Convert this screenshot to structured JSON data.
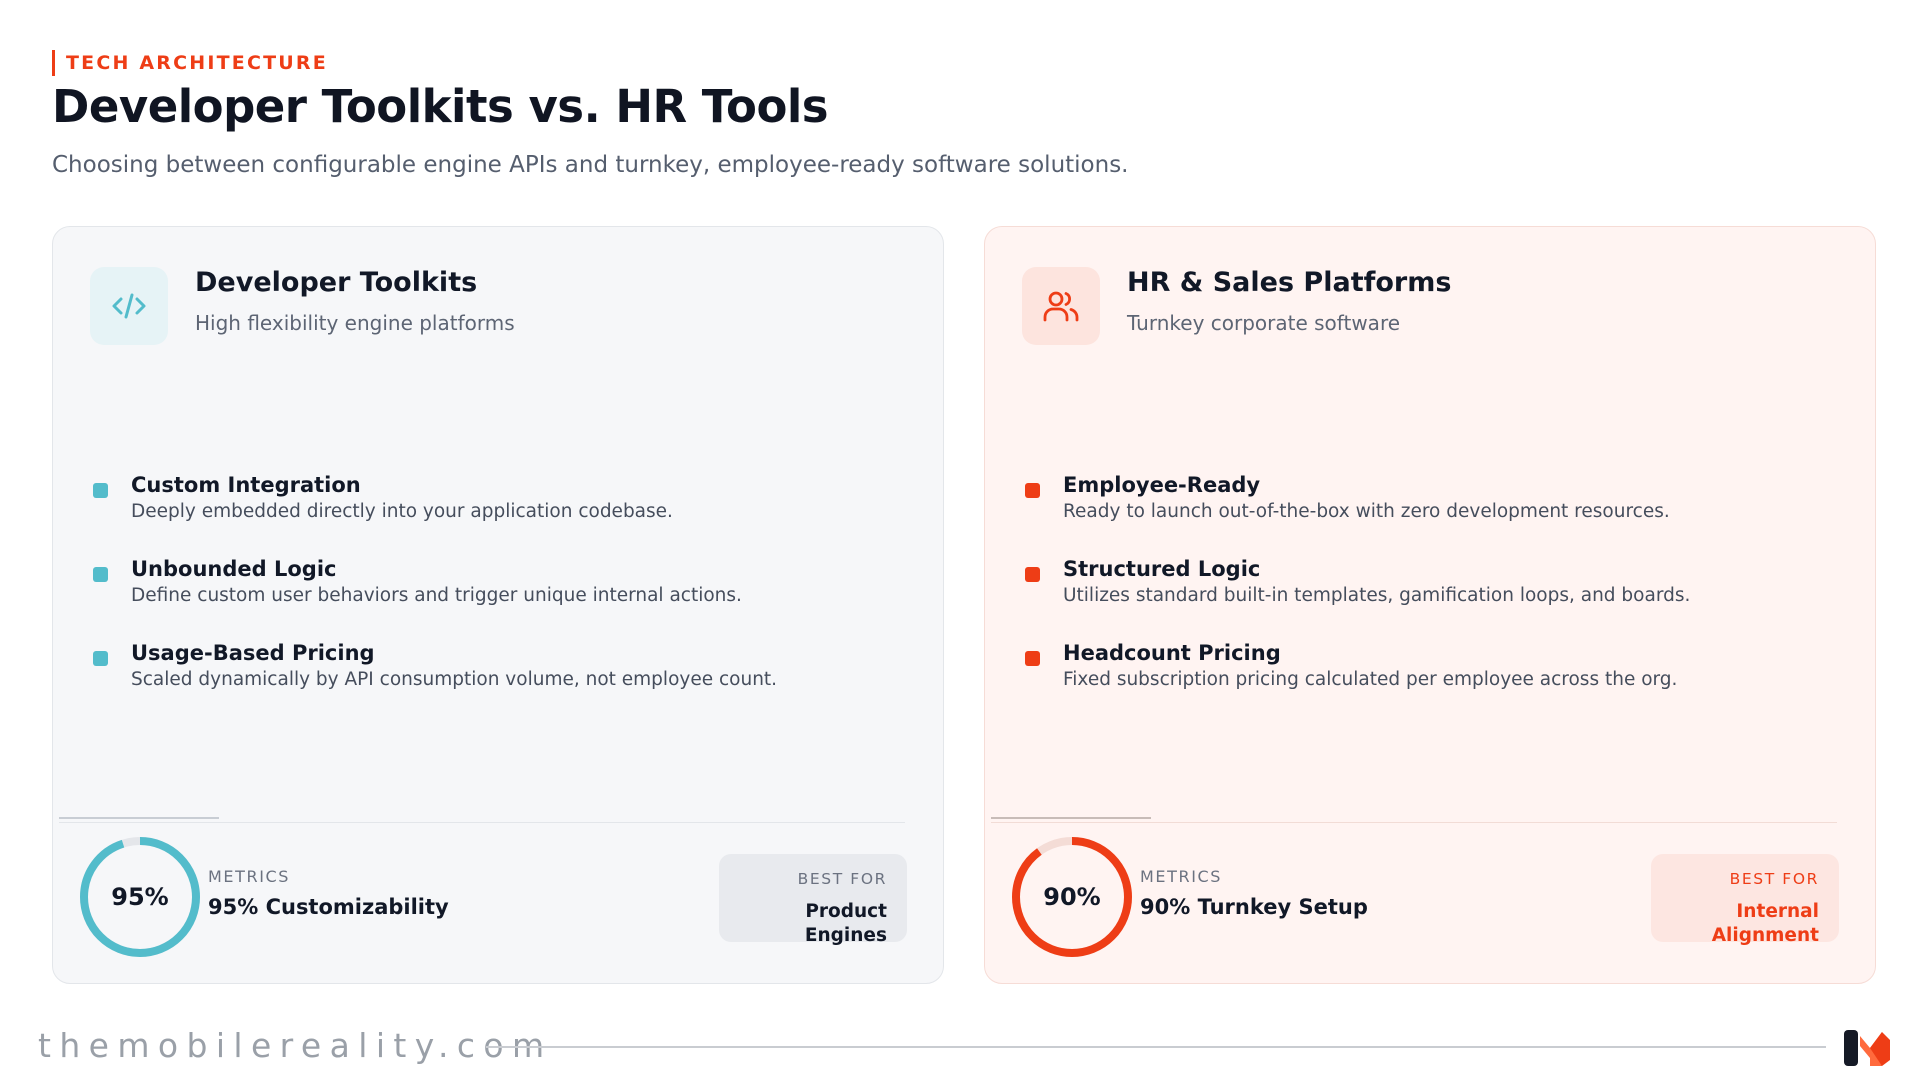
{
  "header": {
    "kicker": "TECH ARCHITECTURE",
    "title": "Developer Toolkits vs. HR Tools",
    "subtitle": "Choosing between configurable engine APIs and turnkey, employee-ready software solutions."
  },
  "cards": {
    "dev": {
      "icon": "code-icon",
      "title": "Developer Toolkits",
      "subtitle": "High flexibility engine platforms",
      "accent": "#53bccb",
      "features": [
        {
          "title": "Custom Integration",
          "desc": "Deeply embedded directly into your application codebase."
        },
        {
          "title": "Unbounded Logic",
          "desc": "Define custom user behaviors and trigger unique internal actions."
        },
        {
          "title": "Usage-Based Pricing",
          "desc": "Scaled dynamically by API consumption volume, not employee count."
        }
      ],
      "metric": {
        "percent": 95,
        "label": "95%",
        "caption": "METRICS",
        "value": "95% Customizability"
      },
      "best_for": {
        "caption": "BEST FOR",
        "value": "Product Engines"
      }
    },
    "hr": {
      "icon": "users-icon",
      "title": "HR & Sales Platforms",
      "subtitle": "Turnkey corporate software",
      "accent": "#ee3d16",
      "features": [
        {
          "title": "Employee-Ready",
          "desc": "Ready to launch out-of-the-box with zero development resources."
        },
        {
          "title": "Structured Logic",
          "desc": "Utilizes standard built-in templates, gamification loops, and boards."
        },
        {
          "title": "Headcount Pricing",
          "desc": "Fixed subscription pricing calculated per employee across the org."
        }
      ],
      "metric": {
        "percent": 90,
        "label": "90%",
        "caption": "METRICS",
        "value": "90% Turnkey Setup"
      },
      "best_for": {
        "caption": "BEST FOR",
        "value": "Internal Alignment"
      }
    }
  },
  "footer": {
    "brand": "themobilereality.com",
    "logo": "mobile-reality-logo"
  }
}
